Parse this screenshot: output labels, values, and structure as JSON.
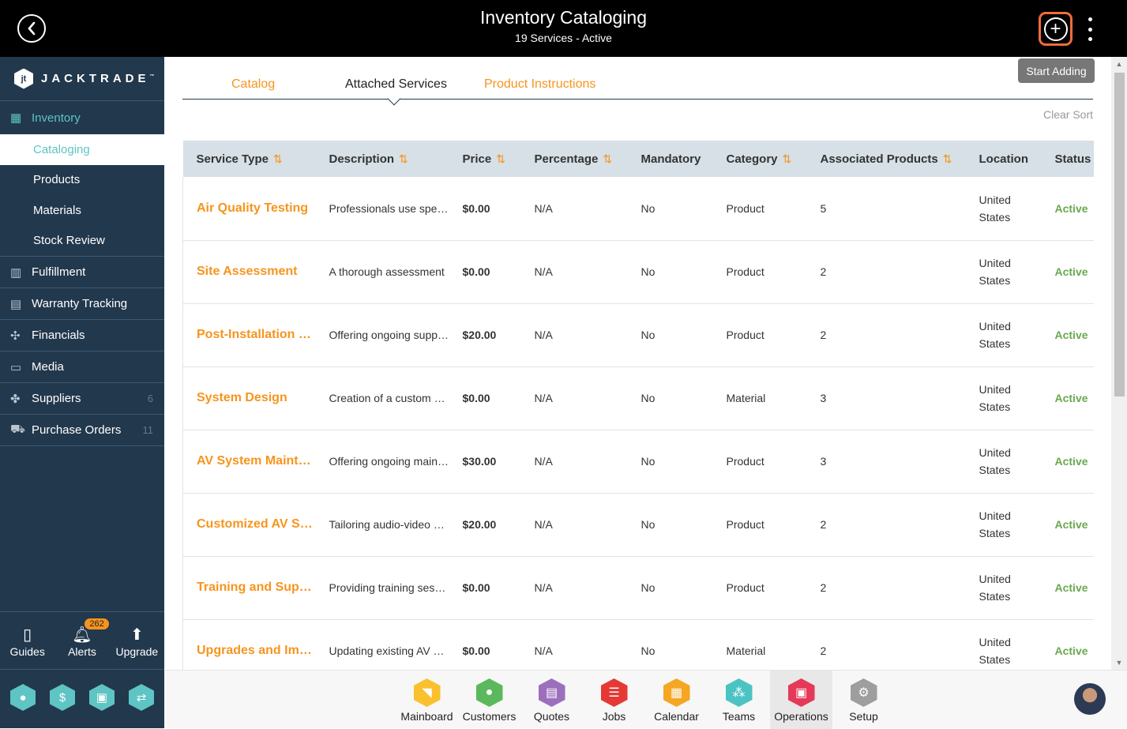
{
  "header": {
    "title": "Inventory Cataloging",
    "subtitle": "19 Services - Active",
    "back_icon": "chevron-left-circle-icon",
    "add_icon": "plus-circle-icon",
    "more_icon": "kebab-menu-icon"
  },
  "brand": {
    "name": "JACKTRADE",
    "tm": "™",
    "mark": "jt"
  },
  "sidebar": {
    "inventory": {
      "label": "Inventory",
      "icon": "inventory-icon"
    },
    "sub_items": [
      {
        "label": "Cataloging",
        "active": true
      },
      {
        "label": "Products"
      },
      {
        "label": "Materials"
      },
      {
        "label": "Stock Review"
      }
    ],
    "items": [
      {
        "label": "Fulfillment",
        "icon": "fulfillment-icon",
        "count": ""
      },
      {
        "label": "Warranty Tracking",
        "icon": "warranty-icon",
        "count": ""
      },
      {
        "label": "Financials",
        "icon": "financials-icon",
        "count": ""
      },
      {
        "label": "Media",
        "icon": "media-icon",
        "count": ""
      },
      {
        "label": "Suppliers",
        "icon": "suppliers-icon",
        "count": "6"
      },
      {
        "label": "Purchase Orders",
        "icon": "purchase-orders-icon",
        "count": "11"
      }
    ],
    "utilities": [
      {
        "label": "Guides",
        "icon": "book-icon"
      },
      {
        "label": "Alerts",
        "icon": "bell-icon",
        "badge": "262"
      },
      {
        "label": "Upgrade",
        "icon": "arrow-up-icon"
      }
    ],
    "quick_icons": [
      "user-icon",
      "dollar-icon",
      "money-icon",
      "workflow-icon"
    ]
  },
  "tabs": [
    {
      "label": "Catalog",
      "active": false
    },
    {
      "label": "Attached Services",
      "active": true
    },
    {
      "label": "Product Instructions",
      "active": false
    }
  ],
  "actions": {
    "start_adding": "Start Adding",
    "clear_sort": "Clear Sort"
  },
  "table": {
    "columns": [
      "Service Type",
      "Description",
      "Price",
      "Percentage",
      "Mandatory",
      "Category",
      "Associated Products",
      "Location",
      "Status"
    ],
    "sortable": [
      true,
      true,
      true,
      true,
      false,
      true,
      true,
      false,
      false
    ],
    "rows": [
      {
        "service": "Air Quality Testing",
        "description": "Professionals use specialized",
        "price": "$0.00",
        "percentage": "N/A",
        "mandatory": "No",
        "category": "Product",
        "assoc": "5",
        "location": "United States",
        "status": "Active"
      },
      {
        "service": "Site Assessment",
        "description": "A thorough assessment",
        "price": "$0.00",
        "percentage": "N/A",
        "mandatory": "No",
        "category": "Product",
        "assoc": "2",
        "location": "United States",
        "status": "Active"
      },
      {
        "service": "Post-Installation Support",
        "description": "Offering ongoing support",
        "price": "$20.00",
        "percentage": "N/A",
        "mandatory": "No",
        "category": "Product",
        "assoc": "2",
        "location": "United States",
        "status": "Active"
      },
      {
        "service": "System Design",
        "description": "Creation of a custom design",
        "price": "$0.00",
        "percentage": "N/A",
        "mandatory": "No",
        "category": "Material",
        "assoc": "3",
        "location": "United States",
        "status": "Active"
      },
      {
        "service": "AV System Maintenance",
        "description": "Offering ongoing maintenance",
        "price": "$30.00",
        "percentage": "N/A",
        "mandatory": "No",
        "category": "Product",
        "assoc": "3",
        "location": "United States",
        "status": "Active"
      },
      {
        "service": "Customized AV Solutions",
        "description": "Tailoring audio-video systems",
        "price": "$20.00",
        "percentage": "N/A",
        "mandatory": "No",
        "category": "Product",
        "assoc": "2",
        "location": "United States",
        "status": "Active"
      },
      {
        "service": "Training and Support",
        "description": "Providing training sessions",
        "price": "$0.00",
        "percentage": "N/A",
        "mandatory": "No",
        "category": "Product",
        "assoc": "2",
        "location": "United States",
        "status": "Active"
      },
      {
        "service": "Upgrades and Improvements",
        "description": "Updating existing AV systems",
        "price": "$0.00",
        "percentage": "N/A",
        "mandatory": "No",
        "category": "Material",
        "assoc": "2",
        "location": "United States",
        "status": "Active"
      }
    ]
  },
  "apps": [
    {
      "label": "Mainboard",
      "icon": "mainboard-icon",
      "color": "#fbc02d",
      "glyph": "◥"
    },
    {
      "label": "Customers",
      "icon": "customer-icon",
      "color": "#5cb85c",
      "glyph": "●"
    },
    {
      "label": "Quotes",
      "icon": "quotes-icon",
      "color": "#9c6fbd",
      "glyph": "▤"
    },
    {
      "label": "Jobs",
      "icon": "jobs-icon",
      "color": "#e53935",
      "glyph": "☰"
    },
    {
      "label": "Calendar",
      "icon": "calendar-icon",
      "color": "#f5a623",
      "glyph": "▦"
    },
    {
      "label": "Teams",
      "icon": "teams-icon",
      "color": "#4cc3c3",
      "glyph": "⁂"
    },
    {
      "label": "Operations",
      "icon": "briefcase-icon",
      "color": "#e53958",
      "glyph": "▣",
      "active": true
    },
    {
      "label": "Setup",
      "icon": "gear-icon",
      "color": "#9e9e9e",
      "glyph": "⚙"
    }
  ],
  "colors": {
    "accent": "#f7941d",
    "teal": "#5ec4c4",
    "sidebar": "#22384d",
    "active_status": "#6aa84f",
    "add_outline": "#f26c3a"
  }
}
